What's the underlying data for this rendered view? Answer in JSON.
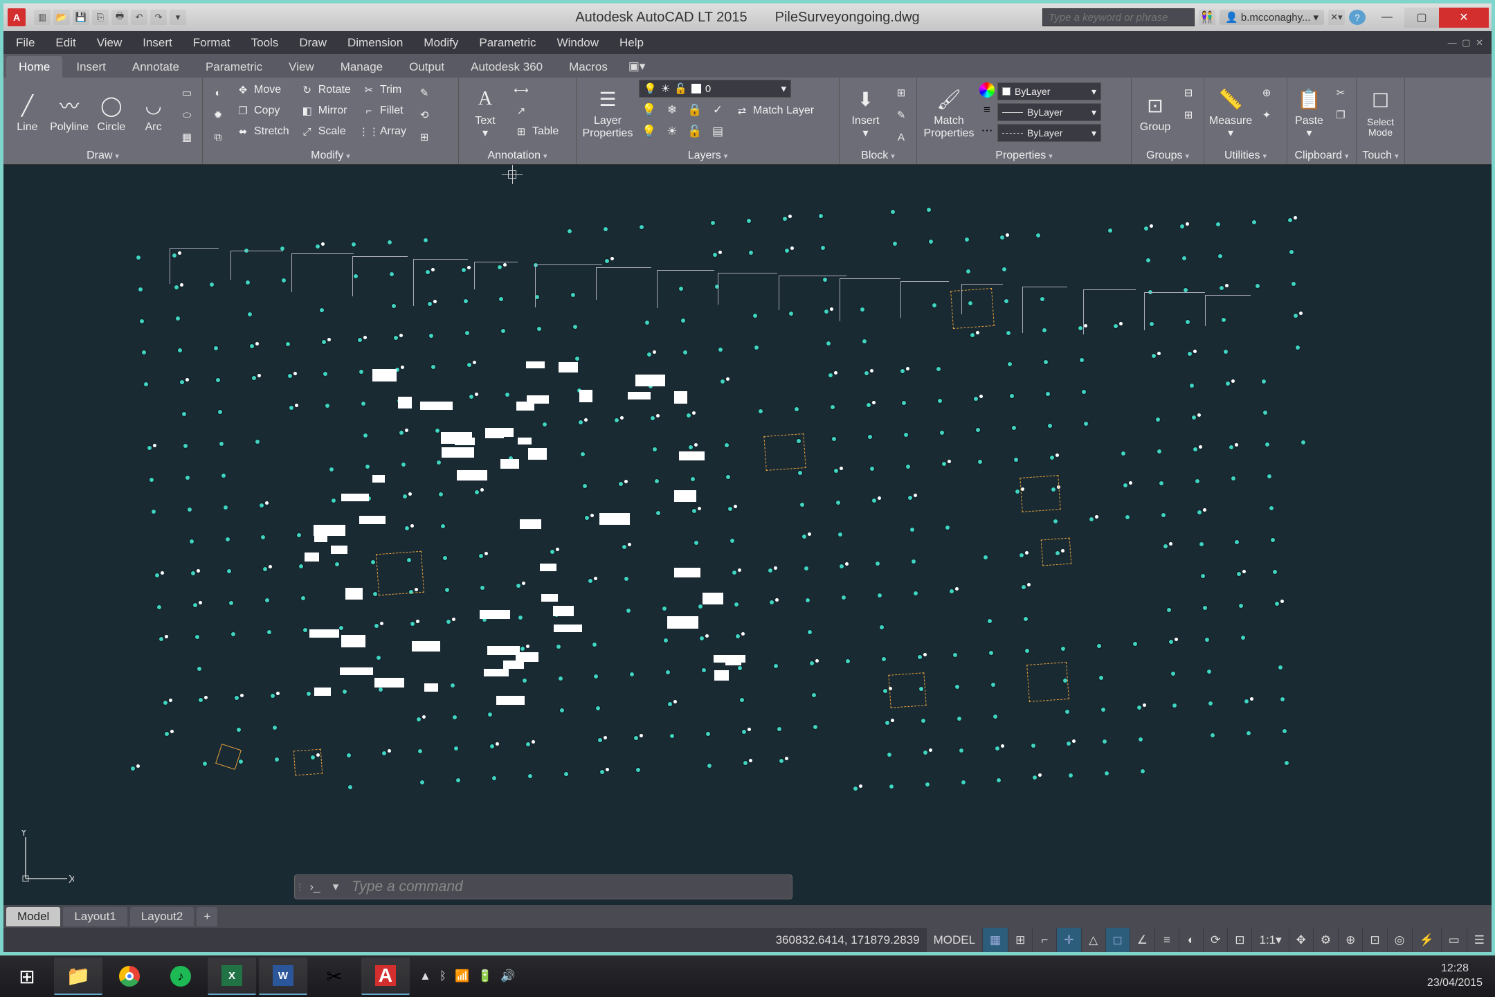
{
  "title": {
    "app": "Autodesk AutoCAD LT 2015",
    "doc": "PileSurveyongoing.dwg"
  },
  "search": {
    "placeholder": "Type a keyword or phrase"
  },
  "user": {
    "name": "b.mcconaghy..."
  },
  "menubar": [
    "File",
    "Edit",
    "View",
    "Insert",
    "Format",
    "Tools",
    "Draw",
    "Dimension",
    "Modify",
    "Parametric",
    "Window",
    "Help"
  ],
  "tabs": [
    "Home",
    "Insert",
    "Annotate",
    "Parametric",
    "View",
    "Manage",
    "Output",
    "Autodesk 360",
    "Macros"
  ],
  "active_tab": "Home",
  "panels": {
    "draw": {
      "title": "Draw",
      "items": [
        "Line",
        "Polyline",
        "Circle",
        "Arc"
      ]
    },
    "modify": {
      "title": "Modify",
      "rowsA": [
        "Move",
        "Copy",
        "Stretch"
      ],
      "rowsB": [
        "Rotate",
        "Mirror",
        "Scale"
      ],
      "rowsC": [
        "Trim",
        "Fillet",
        "Array"
      ]
    },
    "annotation": {
      "title": "Annotation",
      "text": "Text",
      "table": "Table"
    },
    "layers": {
      "title": "Layers",
      "props": "Layer\nProperties",
      "match": "Match Layer",
      "current": "0"
    },
    "block": {
      "title": "Block",
      "insert": "Insert"
    },
    "properties": {
      "title": "Properties",
      "match": "Match\nProperties",
      "dd": [
        "ByLayer",
        "ByLayer",
        "ByLayer"
      ]
    },
    "groups": {
      "title": "Groups",
      "group": "Group"
    },
    "utilities": {
      "title": "Utilities",
      "measure": "Measure"
    },
    "clipboard": {
      "title": "Clipboard",
      "paste": "Paste"
    },
    "touch": {
      "title": "Touch",
      "mode": "Select\nMode"
    }
  },
  "cmd": {
    "placeholder": "Type a command"
  },
  "model_tabs": [
    "Model",
    "Layout1",
    "Layout2"
  ],
  "active_model_tab": "Model",
  "status": {
    "coords": "360832.6414, 171879.2839",
    "mode": "MODEL",
    "scale": "1:1"
  },
  "clock": {
    "time": "12:28",
    "date": "23/04/2015"
  },
  "ucs": {
    "x": "X",
    "y": "Y"
  }
}
